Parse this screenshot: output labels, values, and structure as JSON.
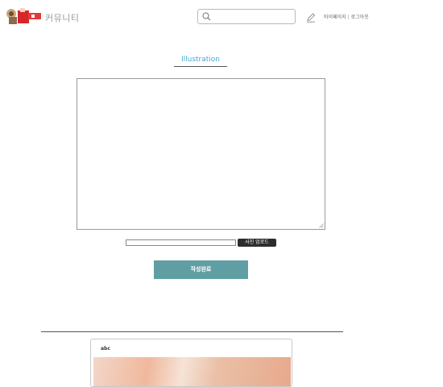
{
  "header": {
    "brand": "커뮤니티",
    "search": {
      "value": "",
      "placeholder": ""
    },
    "nav": {
      "mypage": "마이페이지",
      "separator": "|",
      "logout": "로그아웃"
    }
  },
  "editor": {
    "tab_title": "Illustration",
    "content": ""
  },
  "upload": {
    "file_value": "",
    "button_label": "사진 업로드"
  },
  "submit_label": "작성완료",
  "posts": [
    {
      "title": "abc"
    }
  ],
  "colors": {
    "accent": "#49a6d8",
    "submit": "#5f9fa3",
    "upload_button": "#2d2d2d"
  }
}
